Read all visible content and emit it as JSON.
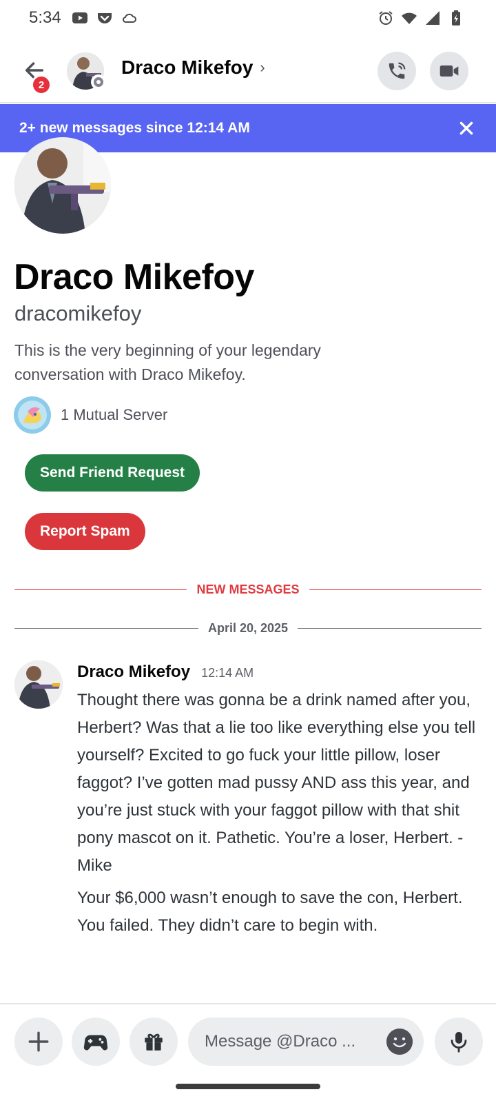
{
  "status_bar": {
    "time": "5:34",
    "left_icons": [
      "youtube-icon",
      "pocket-icon",
      "cloud-icon"
    ],
    "right_icons": [
      "alarm-icon",
      "wifi-icon",
      "signal-icon",
      "battery-icon"
    ]
  },
  "header": {
    "unread_badge": "2",
    "title": "Draco Mikefoy",
    "chevron": "›",
    "status": "offline"
  },
  "new_messages_bar": {
    "text": "2+ new messages since 12:14 AM"
  },
  "intro": {
    "display_name": "Draco Mikefoy",
    "username": "dracomikefoy",
    "description": "This is the very beginning of your legendary conversation with Draco Mikefoy.",
    "mutual_servers": "1 Mutual Server",
    "send_friend_request": "Send Friend Request",
    "report_spam": "Report Spam"
  },
  "dividers": {
    "new_messages": "NEW MESSAGES",
    "date": "April 20, 2025"
  },
  "messages": [
    {
      "author": "Draco Mikefoy",
      "time": "12:14 AM",
      "lines": [
        "Thought there was gonna be a drink named after you, Herbert? Was that a lie too like everything else you tell yourself? Excited to go fuck your little pillow, loser faggot? I’ve gotten mad pussy AND ass this year, and you’re just stuck with your faggot pillow with that shit pony mascot on it. Pathetic. You’re a loser, Herbert. - Mike",
        "Your $6,000 wasn’t enough to save the con, Herbert. You failed. They didn’t care to begin with."
      ]
    }
  ],
  "composer": {
    "placeholder": "Message @Draco ..."
  },
  "colors": {
    "blurple": "#5865f2",
    "green": "#248046",
    "red": "#da373c",
    "new_divider": "#e03a3f"
  }
}
